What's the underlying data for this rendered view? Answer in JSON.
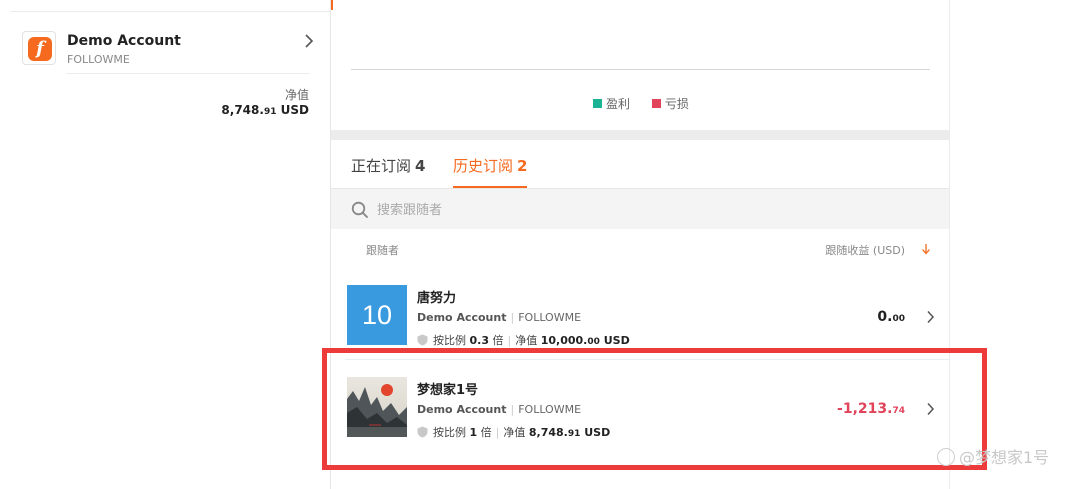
{
  "account": {
    "name": "Demo Account",
    "broker": "FOLLOWME",
    "logo_letter": "f",
    "equity_label": "净值",
    "equity_int": "8,748.",
    "equity_dec": "91",
    "equity_unit": " USD"
  },
  "legend": {
    "profit_label": "盈利",
    "profit_color": "#1ab394",
    "loss_label": "亏损",
    "loss_color": "#e0435a"
  },
  "tabs": [
    {
      "label": "正在订阅",
      "count": "4",
      "active": false
    },
    {
      "label": "历史订阅",
      "count": "2",
      "active": true
    }
  ],
  "search": {
    "placeholder": "搜索跟随者"
  },
  "columns": {
    "follower": "跟随者",
    "profit": "跟随收益 (USD)"
  },
  "followers": [
    {
      "avatar_text": "10",
      "name": "唐努力",
      "account": "Demo Account",
      "broker": "FOLLOWME",
      "ratio_label": "按比例",
      "ratio_value": "0.3",
      "ratio_unit": "倍",
      "equity_label": "净值",
      "equity_int": "10,000.",
      "equity_dec": "00",
      "equity_unit": " USD",
      "profit_int": "0.",
      "profit_dec": "00"
    },
    {
      "avatar_text": "",
      "name": "梦想家1号",
      "account": "Demo Account",
      "broker": "FOLLOWME",
      "ratio_label": "按比例",
      "ratio_value": "1",
      "ratio_unit": "倍",
      "equity_label": "净值",
      "equity_int": "8,748.",
      "equity_dec": "91",
      "equity_unit": " USD",
      "profit_int": "-1,213.",
      "profit_dec": "74"
    }
  ],
  "watermark": "@梦想家1号",
  "accent_color": "#f56a1f",
  "highlight_color": "#ed3b3b"
}
